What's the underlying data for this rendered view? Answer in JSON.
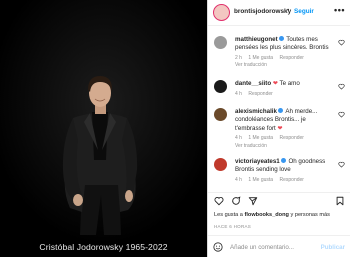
{
  "photo": {
    "caption": "Cristóbal Jodorowsky 1965-2022"
  },
  "header": {
    "username": "brontisjodorowsky",
    "separator": "•",
    "follow_label": "Seguir",
    "more_icon": "more-horizontal-icon"
  },
  "comments": [
    {
      "username": "matthieugonet",
      "text": "Toutes mes pensées les plus sincères. Brontis",
      "meta": [
        "2 h",
        "1 Me gusta",
        "Responder"
      ],
      "translation": "Ver traducción",
      "avatar_color": "#9a9a9a"
    },
    {
      "username": "dante__siito",
      "text": "Te amo",
      "meta": [
        "4 h",
        "Responder"
      ],
      "translation": "",
      "avatar_color": "#1a1a1a"
    },
    {
      "username": "alexismichalik",
      "text": "Ah merde... condoléances Brontis... je t'embrasse fort",
      "meta": [
        "4 h",
        "1 Me gusta",
        "Responder"
      ],
      "translation": "Ver traducción",
      "avatar_color": "#6b4a2a"
    },
    {
      "username": "victoriayeates1",
      "text": "Oh goodness Brontis sending love",
      "meta": [
        "4 h",
        "1 Me gusta",
        "Responder"
      ],
      "translation": "",
      "avatar_color": "#c0392b"
    }
  ],
  "likes": {
    "prefix": "Les gusta a ",
    "user": "flowbooks_dong",
    "suffix": " y personas más"
  },
  "time_ago": "HACE 6 HORAS",
  "add_comment": {
    "placeholder": "Añade un comentario...",
    "publish_label": "Publicar"
  },
  "colors": {
    "accent": "#0095f6",
    "heart": "#ed4956",
    "verified": "#3897f0"
  }
}
